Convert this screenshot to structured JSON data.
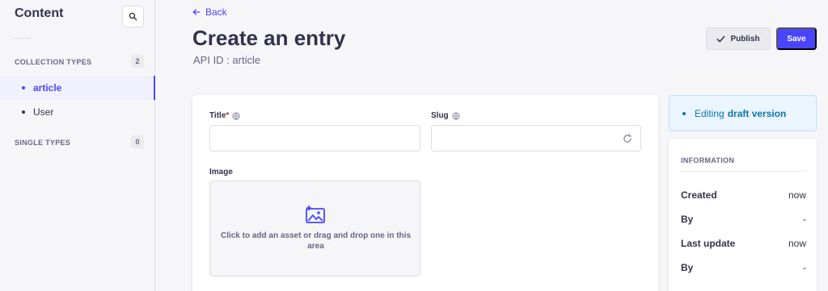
{
  "sidebar": {
    "title": "Content",
    "collection_types": {
      "label": "COLLECTION TYPES",
      "count": "2",
      "items": [
        "article",
        "User"
      ]
    },
    "single_types": {
      "label": "SINGLE TYPES",
      "count": "0"
    }
  },
  "header": {
    "back_label": "Back",
    "title": "Create an entry",
    "api_id": "API ID : article",
    "publish_label": "Publish",
    "save_label": "Save"
  },
  "form": {
    "title_label": "Title",
    "title_required": "*",
    "title_value": "",
    "slug_label": "Slug",
    "slug_value": "",
    "image_label": "Image",
    "image_dropzone_text": "Click to add an asset or drag and drop one in this area"
  },
  "status": {
    "prefix": "Editing",
    "version": "draft version"
  },
  "information": {
    "heading": "INFORMATION",
    "rows": [
      {
        "key": "Created",
        "value": "now"
      },
      {
        "key": "By",
        "value": "-"
      },
      {
        "key": "Last update",
        "value": "now"
      },
      {
        "key": "By",
        "value": "-"
      }
    ]
  },
  "colors": {
    "accent": "#4945ff",
    "draft_text": "#0c75af",
    "draft_bg": "#eaf5ff",
    "required": "#d02b20"
  },
  "icons": [
    "search-icon",
    "arrow-left-icon",
    "check-icon",
    "globe-icon",
    "refresh-icon",
    "image-add-icon"
  ]
}
